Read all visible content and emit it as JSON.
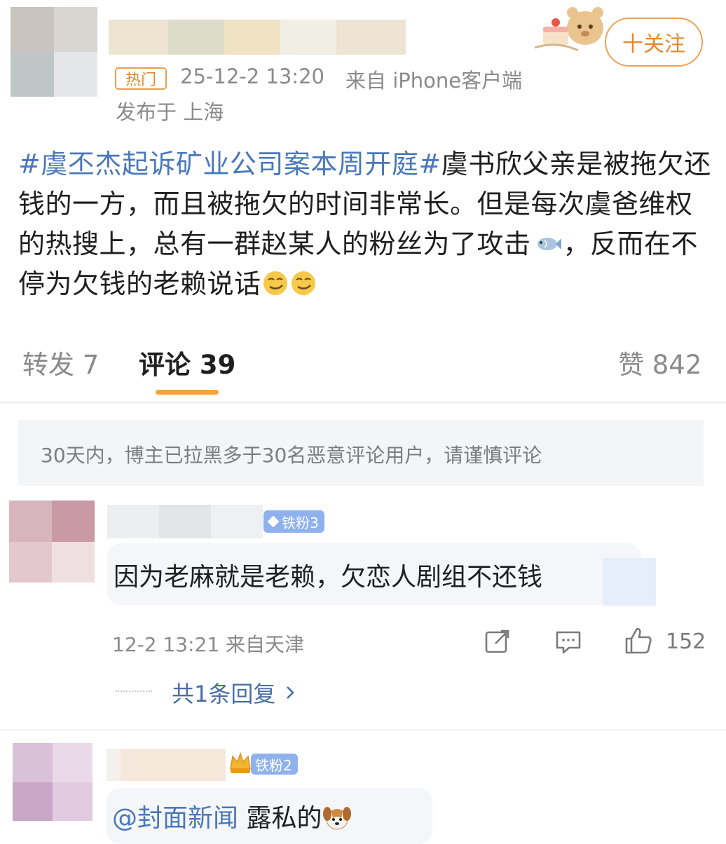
{
  "post": {
    "follow_label": "十关注",
    "hot_tag": "热门",
    "timestamp": "25-12-2 13:20",
    "source": "来自 iPhone客户端",
    "location": "发布于 上海",
    "topic": "#虞丕杰起诉矿业公司案本周开庭#",
    "body_1": "虞书欣父亲是被拖欠还钱的一方，而且被拖欠的时间非常长。但是每次虞爸维权的热搜上，总有一群赵某人的粉丝为了攻击",
    "body_2": "，反而在不停为欠钱的老赖说话",
    "fish_icon": "fish-emoji",
    "smirk_icon": "smirk-emoji"
  },
  "tabs": {
    "repost": "转发 7",
    "comments": "评论 39",
    "likes": "赞 842"
  },
  "notice": "30天内，博主已拉黑多于30名恶意评论用户，请谨慎评论",
  "comments": [
    {
      "badge": "铁粉3",
      "text": "因为老麻就是老赖，欠恋人剧组不还钱",
      "time_location": "12-2 13:21 来自天津",
      "like_count": "152",
      "replies_label": "共1条回复",
      "icons": [
        "share-icon",
        "comment-icon",
        "like-icon"
      ],
      "accent": "#8fb2ef"
    },
    {
      "badge": "铁粉2",
      "mention": "@封面新闻",
      "text": " 露私的",
      "accent": "#8fb2ef"
    }
  ],
  "colors": {
    "topic": "#4a78b8",
    "follow": "#e8872c",
    "tab_underline": "#f7a539"
  }
}
